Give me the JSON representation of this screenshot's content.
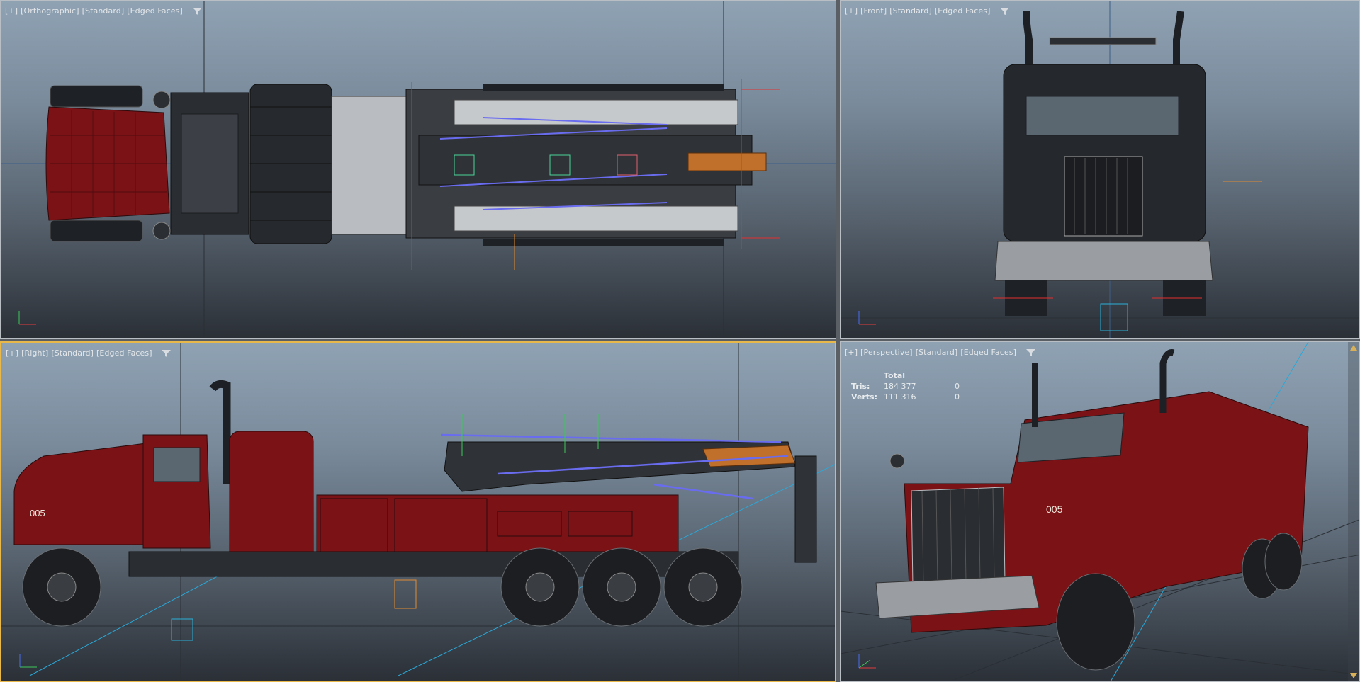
{
  "viewports": {
    "top": {
      "label_parts": [
        "[+]",
        "[Orthographic]",
        "[Standard]",
        "[Edged Faces]"
      ]
    },
    "front": {
      "label_parts": [
        "[+]",
        "[Front]",
        "[Standard]",
        "[Edged Faces]"
      ]
    },
    "right": {
      "label_parts": [
        "[+]",
        "[Right]",
        "[Standard]",
        "[Edged Faces]"
      ]
    },
    "perspective": {
      "label_parts": [
        "[+]",
        "[Perspective]",
        "[Standard]",
        "[Edged Faces]"
      ],
      "stats": {
        "header": "Total",
        "tris_label": "Tris:",
        "tris_total": "184 377",
        "tris_sel": "0",
        "verts_label": "Verts:",
        "verts_total": "111 316",
        "verts_sel": "0"
      }
    }
  },
  "truck_number": "005",
  "colors": {
    "active_border": "#e8b84a",
    "truck_red": "#7a1216",
    "boom_orange": "#c0702a",
    "bone_blue": "#6a6cf0"
  },
  "icons": [
    "filter-icon",
    "axis-gizmo-icon"
  ]
}
